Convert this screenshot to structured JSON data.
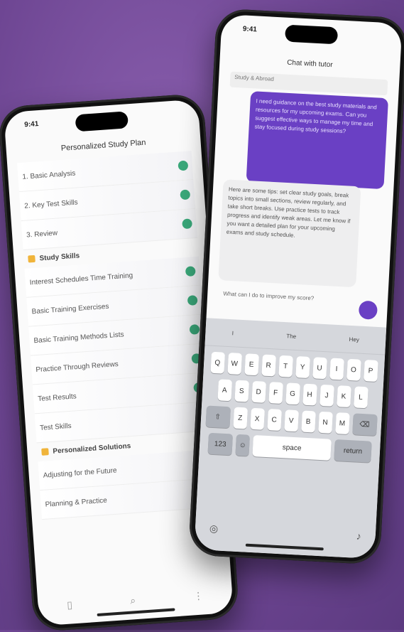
{
  "left_phone": {
    "time": "9:41",
    "title": "Personalized Study Plan",
    "items_top": [
      {
        "label": "1. Basic Analysis"
      },
      {
        "label": "2. Key Test Skills"
      },
      {
        "label": "3. Review"
      }
    ],
    "section1": "Study Skills",
    "items_mid": [
      {
        "label": "Interest Schedules Time Training"
      },
      {
        "label": "Basic Training Exercises"
      },
      {
        "label": "Basic Training Methods Lists"
      },
      {
        "label": "Practice Through Reviews"
      },
      {
        "label": "Test Results"
      },
      {
        "label": "Test Skills"
      }
    ],
    "section2": "Personalized Solutions",
    "items_bottom": [
      {
        "label": "Adjusting for the Future"
      },
      {
        "label": "Planning & Practice"
      }
    ],
    "tabs": [
      "▯",
      "⌕",
      "⋮"
    ]
  },
  "right_phone": {
    "time": "9:41",
    "title": "Chat with tutor",
    "topic": "Study & Abroad",
    "user_message": "I need guidance on the best study materials and resources for my upcoming exams. Can you suggest effective ways to manage my time and stay focused during study sessions?",
    "ai_message": "Here are some tips: set clear study goals, break topics into small sections, review regularly, and take short breaks. Use practice tests to track progress and identify weak areas. Let me know if you want a detailed plan for your upcoming exams and study schedule.",
    "compose_text": "What can I do to improve my score?",
    "suggestions": [
      "I",
      "The",
      "Hey"
    ],
    "keys_row1": [
      "Q",
      "W",
      "E",
      "R",
      "T",
      "Y",
      "U",
      "I",
      "O",
      "P"
    ],
    "keys_row2": [
      "A",
      "S",
      "D",
      "F",
      "G",
      "H",
      "J",
      "K",
      "L"
    ],
    "keys_row3": [
      "Z",
      "X",
      "C",
      "V",
      "B",
      "N",
      "M"
    ],
    "space_label": "space",
    "return_label": "return",
    "num_label": "123"
  }
}
